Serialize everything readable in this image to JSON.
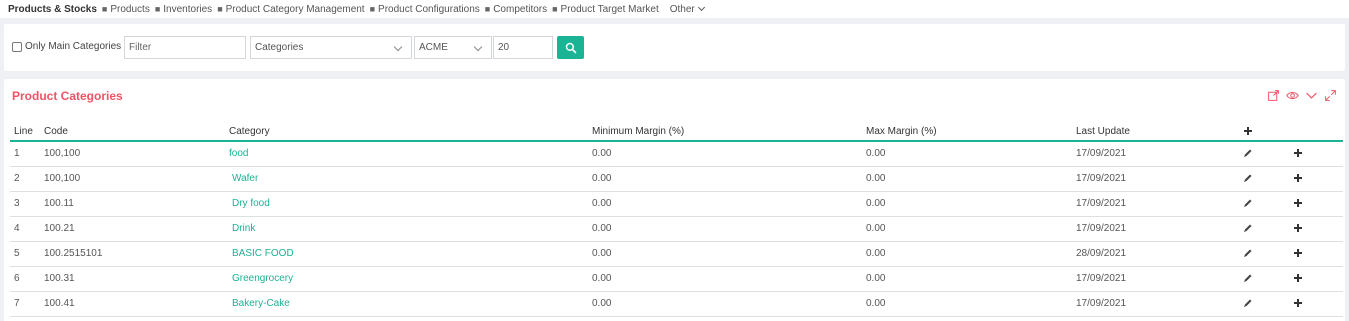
{
  "topnav": {
    "brand": "Products & Stocks",
    "items": [
      {
        "label": "Products"
      },
      {
        "label": "Inventories"
      },
      {
        "label": "Product Category Management"
      },
      {
        "label": "Product Configurations"
      },
      {
        "label": "Competitors"
      },
      {
        "label": "Product Target Market"
      }
    ],
    "other_label": "Other"
  },
  "filters": {
    "only_main_label": "Only Main Categories",
    "only_main_checked": false,
    "filter_placeholder": "Filter",
    "category_select": "Categories",
    "company_select": "ACME",
    "page_size": "20",
    "search_icon": "search-icon"
  },
  "panel": {
    "title": "Product Categories",
    "tool_icons": [
      "export-icon",
      "eye-icon",
      "chevron-down-icon",
      "expand-icon"
    ]
  },
  "table": {
    "headers": {
      "line": "Line",
      "code": "Code",
      "category": "Category",
      "min_margin": "Minimum Margin (%)",
      "max_margin": "Max Margin (%)",
      "last_update": "Last Update",
      "add_icon": "plus-icon"
    },
    "rows": [
      {
        "line": "1",
        "code": "100,100",
        "category": "food",
        "min_margin": "0.00",
        "max_margin": "0.00",
        "last_update": "17/09/2021"
      },
      {
        "line": "2",
        "code": "100,100",
        "category": "Wafer",
        "min_margin": "0.00",
        "max_margin": "0.00",
        "last_update": "17/09/2021"
      },
      {
        "line": "3",
        "code": "100.11",
        "category": "Dry food",
        "min_margin": "0.00",
        "max_margin": "0.00",
        "last_update": "17/09/2021"
      },
      {
        "line": "4",
        "code": "100.21",
        "category": "Drink",
        "min_margin": "0.00",
        "max_margin": "0.00",
        "last_update": "17/09/2021"
      },
      {
        "line": "5",
        "code": "100.2515101",
        "category": "BASIC FOOD",
        "min_margin": "0.00",
        "max_margin": "0.00",
        "last_update": "28/09/2021"
      },
      {
        "line": "6",
        "code": "100.31",
        "category": "Greengrocery",
        "min_margin": "0.00",
        "max_margin": "0.00",
        "last_update": "17/09/2021"
      },
      {
        "line": "7",
        "code": "100.41",
        "category": "Bakery-Cake",
        "min_margin": "0.00",
        "max_margin": "0.00",
        "last_update": "17/09/2021"
      }
    ],
    "row_icons": [
      "pencil-icon",
      "plus-icon"
    ]
  },
  "colors": {
    "accent": "#1ab394",
    "title_red": "#ed5565",
    "background": "#eef0f3"
  }
}
